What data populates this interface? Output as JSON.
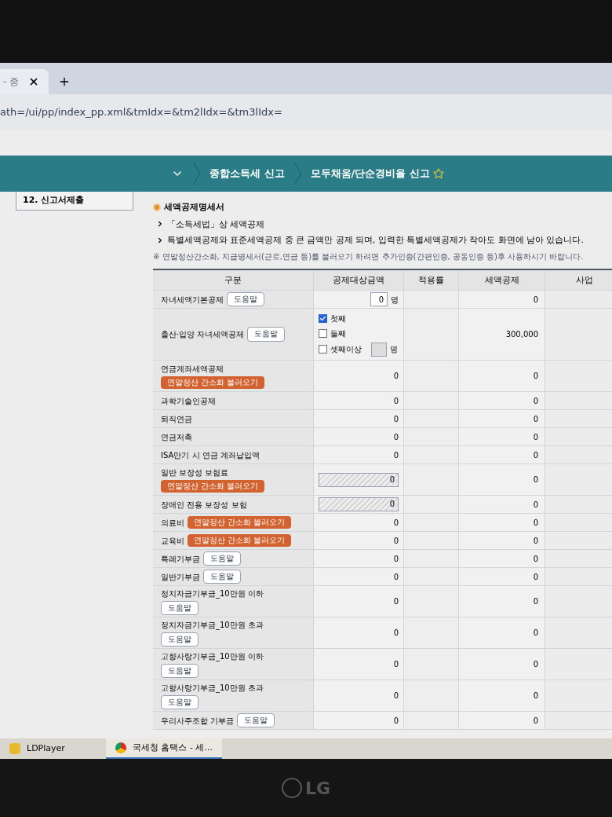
{
  "browser": {
    "tab_title": "- 종",
    "address": "ath=/ui/pp/index_pp.xml&tmIdx=&tm2lIdx=&tm3lIdx="
  },
  "nav": {
    "items": [
      {
        "label": "종합소득세 신고",
        "starred": false
      },
      {
        "label": "모두채움/단순경비율 신고",
        "starred": true
      }
    ]
  },
  "sidebar": {
    "items": [
      {
        "label": "12. 신고서제출"
      }
    ]
  },
  "section": {
    "title": "세액공제명세서",
    "bullets": [
      "「소득세법」상 세액공제",
      "특별세액공제와 표준세액공제 중 큰 금액만 공제 되며, 입력한 특별세액공제가 작아도 화면에 남아 있습니다."
    ],
    "note": "※ 연말정산간소화, 지급명세서(근로,연금 등)를 불러오기 하려면 추가인증(간편인증, 공동인증 등)후 사용하시기 바랍니다."
  },
  "table": {
    "columns": [
      "구분",
      "공제대상금액",
      "적용률",
      "세액공제",
      "사업"
    ],
    "rows": [
      {
        "label": "자녀세액기본공제",
        "kind": "inline",
        "button": {
          "kind": "help",
          "label": "도움말"
        },
        "amount": {
          "kind": "count",
          "value": "0",
          "unit": "명"
        },
        "credit": "0"
      },
      {
        "label": "출산·입양 자녀세액공제",
        "kind": "inline",
        "button": {
          "kind": "help",
          "label": "도움말"
        },
        "amount": {
          "kind": "checks",
          "options": [
            {
              "label": "첫째",
              "checked": true
            },
            {
              "label": "둘째",
              "checked": false
            },
            {
              "label": "셋째이상",
              "checked": false,
              "unit": "명"
            }
          ]
        },
        "credit": "300,000"
      },
      {
        "label": "연금계좌세액공제",
        "kind": "stacked",
        "button": {
          "kind": "import",
          "label": "연말정산 간소화 불러오기"
        },
        "amount": {
          "kind": "text",
          "value": "0"
        },
        "credit": "0"
      },
      {
        "label": "과학기술인공제",
        "amount": {
          "kind": "text",
          "value": "0"
        },
        "credit": "0"
      },
      {
        "label": "퇴직연금",
        "amount": {
          "kind": "text",
          "value": "0"
        },
        "credit": "0"
      },
      {
        "label": "연금저축",
        "amount": {
          "kind": "text",
          "value": "0"
        },
        "credit": "0"
      },
      {
        "label": "ISA만기 시 연금 계좌납입액",
        "amount": {
          "kind": "text",
          "value": "0"
        },
        "credit": "0"
      },
      {
        "label": "일반 보장성 보험료",
        "kind": "stacked",
        "button": {
          "kind": "import",
          "label": "연말정산 간소화 불러오기"
        },
        "amount": {
          "kind": "locked",
          "value": "0"
        },
        "credit": "0"
      },
      {
        "label": "장애인 전용 보장성 보험",
        "amount": {
          "kind": "locked",
          "value": "0"
        },
        "credit": "0"
      },
      {
        "label": "의료비",
        "kind": "inline",
        "button": {
          "kind": "import",
          "label": "연말정산 간소화 불러오기"
        },
        "amount": {
          "kind": "text",
          "value": "0"
        },
        "credit": "0"
      },
      {
        "label": "교육비",
        "kind": "inline",
        "button": {
          "kind": "import",
          "label": "연말정산 간소화 불러오기"
        },
        "amount": {
          "kind": "text",
          "value": "0"
        },
        "credit": "0"
      },
      {
        "label": "특례기부금",
        "kind": "inline",
        "button": {
          "kind": "help",
          "label": "도움말"
        },
        "amount": {
          "kind": "text",
          "value": "0"
        },
        "credit": "0"
      },
      {
        "label": "일반기부금",
        "kind": "inline",
        "button": {
          "kind": "help",
          "label": "도움말"
        },
        "amount": {
          "kind": "text",
          "value": "0"
        },
        "credit": "0"
      },
      {
        "label": "정치자금기부금_10만원 이하",
        "kind": "stacked",
        "button": {
          "kind": "help",
          "label": "도움말"
        },
        "amount": {
          "kind": "text",
          "value": "0"
        },
        "credit": "0"
      },
      {
        "label": "정치자금기부금_10만원 초과",
        "kind": "stacked",
        "button": {
          "kind": "help",
          "label": "도움말"
        },
        "amount": {
          "kind": "text",
          "value": "0"
        },
        "credit": "0"
      },
      {
        "label": "고향사랑기부금_10만원 이하",
        "kind": "stacked",
        "button": {
          "kind": "help",
          "label": "도움말"
        },
        "amount": {
          "kind": "text",
          "value": "0"
        },
        "credit": "0"
      },
      {
        "label": "고향사랑기부금_10만원 초과",
        "kind": "stacked",
        "button": {
          "kind": "help",
          "label": "도움말"
        },
        "amount": {
          "kind": "text",
          "value": "0"
        },
        "credit": "0"
      },
      {
        "label": "우리사주조합 기부금",
        "kind": "inline",
        "button": {
          "kind": "help",
          "label": "도움말"
        },
        "amount": {
          "kind": "text",
          "value": "0"
        },
        "credit": "0"
      }
    ]
  },
  "taskbar": {
    "items": [
      {
        "label": "LDPlayer",
        "kind": "emulator",
        "selected": false
      },
      {
        "label": "국세청 홈택스 - 세...",
        "kind": "browser",
        "selected": true
      }
    ]
  },
  "monitor": {
    "brand": "LG"
  }
}
